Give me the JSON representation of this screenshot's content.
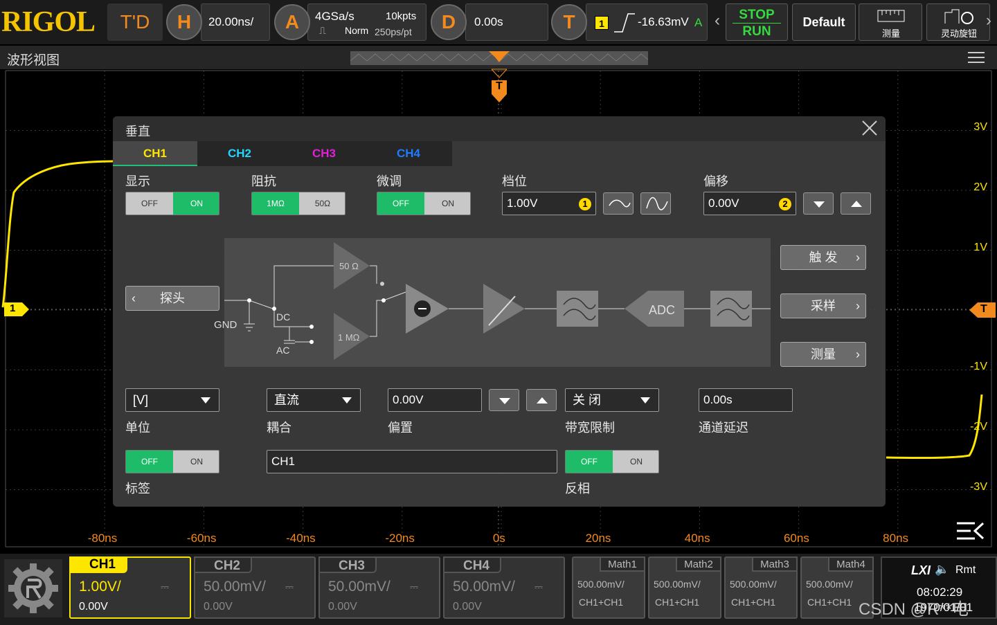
{
  "top_bar": {
    "logo": "RIGOL",
    "mode": "T'D",
    "horizontal_icon": "H",
    "timebase": "20.00ns/",
    "acquire_icon": "A",
    "sample_rate": "4GSa/s",
    "memory_depth": "10kpts",
    "acq_mode": "Norm",
    "sample_interval": "250ps/pt",
    "delay_icon": "D",
    "delay": "0.00s",
    "trigger_icon": "T",
    "trigger_source": "1",
    "trigger_level": "-16.63mV",
    "trigger_status": "A",
    "stop_label": "STOP",
    "run_label": "RUN",
    "default_label": "Default",
    "measure_label": "测量",
    "knob_label": "灵动旋钮"
  },
  "view": {
    "title": "波形视图",
    "trigger_marker": "T",
    "ch1_marker": "1",
    "right_trigger_marker": "T",
    "y_ticks": [
      "3V",
      "2V",
      "1V",
      "-1V",
      "-2V",
      "-3V"
    ],
    "x_ticks": [
      "-80ns",
      "-60ns",
      "-40ns",
      "-20ns",
      "0s",
      "20ns",
      "40ns",
      "60ns",
      "80ns"
    ]
  },
  "dialog": {
    "title": "垂直",
    "tabs": [
      {
        "label": "CH1",
        "color": "#ffe600"
      },
      {
        "label": "CH2",
        "color": "#24d6ff"
      },
      {
        "label": "CH3",
        "color": "#e21fd8"
      },
      {
        "label": "CH4",
        "color": "#1d7cff"
      }
    ],
    "display_label": "显示",
    "impedance_label": "阻抗",
    "fine_label": "微调",
    "scale_label": "档位",
    "offset_label": "偏移",
    "display": {
      "off": "OFF",
      "on": "ON"
    },
    "impedance": {
      "a": "1MΩ",
      "b": "50Ω"
    },
    "fine": {
      "off": "OFF",
      "on": "ON"
    },
    "scale_value": "1.00V",
    "scale_knob": "1",
    "offset_value": "0.00V",
    "offset_knob": "2",
    "probe_label": "探头",
    "diagram": {
      "r50": "50 Ω",
      "r1m": "1 MΩ",
      "gnd": "GND",
      "dc": "DC",
      "ac": "AC",
      "adc": "ADC"
    },
    "trigger_btn": "触 发",
    "acquire_btn": "采样",
    "measure_btn": "测量",
    "unit_value": "[V]",
    "unit_label": "单位",
    "coupling_value": "直流",
    "coupling_label": "耦合",
    "bias_value": "0.00V",
    "bias_label": "偏置",
    "bw_value": "关 闭",
    "bw_label": "带宽限制",
    "delay_value": "0.00s",
    "delay_label": "通道延迟",
    "tag": {
      "off": "OFF",
      "on": "ON"
    },
    "tag_label": "标签",
    "tag_text": "CH1",
    "invert": {
      "off": "OFF",
      "on": "ON"
    },
    "invert_label": "反相"
  },
  "channels": [
    {
      "name": "CH1",
      "scale": "1.00V/",
      "offset": "0.00V",
      "color": "#ffe600",
      "active": true
    },
    {
      "name": "CH2",
      "scale": "50.00mV/",
      "offset": "0.00V",
      "color": "#24d6ff",
      "active": false
    },
    {
      "name": "CH3",
      "scale": "50.00mV/",
      "offset": "0.00V",
      "color": "#e21fd8",
      "active": false
    },
    {
      "name": "CH4",
      "scale": "50.00mV/",
      "offset": "0.00V",
      "color": "#1d7cff",
      "active": false
    }
  ],
  "maths": [
    {
      "name": "Math1",
      "scale": "500.00mV/",
      "source": "CH1+CH1"
    },
    {
      "name": "Math2",
      "scale": "500.00mV/",
      "source": "CH1+CH1"
    },
    {
      "name": "Math3",
      "scale": "500.00mV/",
      "source": "CH1+CH1"
    },
    {
      "name": "Math4",
      "scale": "500.00mV/",
      "source": "CH1+CH1"
    }
  ],
  "status": {
    "lxi": "LXI",
    "rmt": "Rmt",
    "time": "08:02:29",
    "date": "1970/01/01",
    "watermark": "CSDN @R**电"
  }
}
